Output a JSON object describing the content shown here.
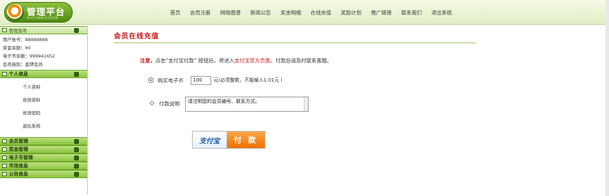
{
  "logo": {
    "title": "管理平台",
    "subtitle": "PLATFORM SYSTEM"
  },
  "nav": {
    "items": [
      "首页",
      "会员注册",
      "网络图谱",
      "新闻公告",
      "奖金明细",
      "在线充值",
      "奖励计划",
      "推广链接",
      "联系我们",
      "退出系统"
    ]
  },
  "sidebar": {
    "manage_header": "管理选项",
    "user_info": [
      "用户账号：88888888",
      "奖金余额：¥0",
      "电子币余额：999941652",
      "会员级别：金牌会员"
    ],
    "personal_header": "个人信息",
    "personal_items": [
      "个人资料",
      "修改资料",
      "修改密码",
      "退出系统"
    ],
    "sections": [
      "会员管理",
      "奖金管理",
      "电子币管理",
      "市场信息",
      "公告信息"
    ]
  },
  "main": {
    "title": "会员在线充值",
    "notice": {
      "prefix": "注意，",
      "text_before": "点击“支付宝付款” 按钮后，将进入",
      "link": "支付宝官方页面",
      "text_after": "，付款后请及时联系客服。"
    },
    "amount": {
      "label": "购买电子币",
      "value": "100",
      "unit_hint": "元(必须整数，不能输入1.01元 )"
    },
    "description": {
      "label": "付款说明",
      "value": "请注明您的会员编号、联系方式。"
    },
    "pay_button": {
      "logo_text": "支付宝",
      "label": "付 款"
    }
  }
}
